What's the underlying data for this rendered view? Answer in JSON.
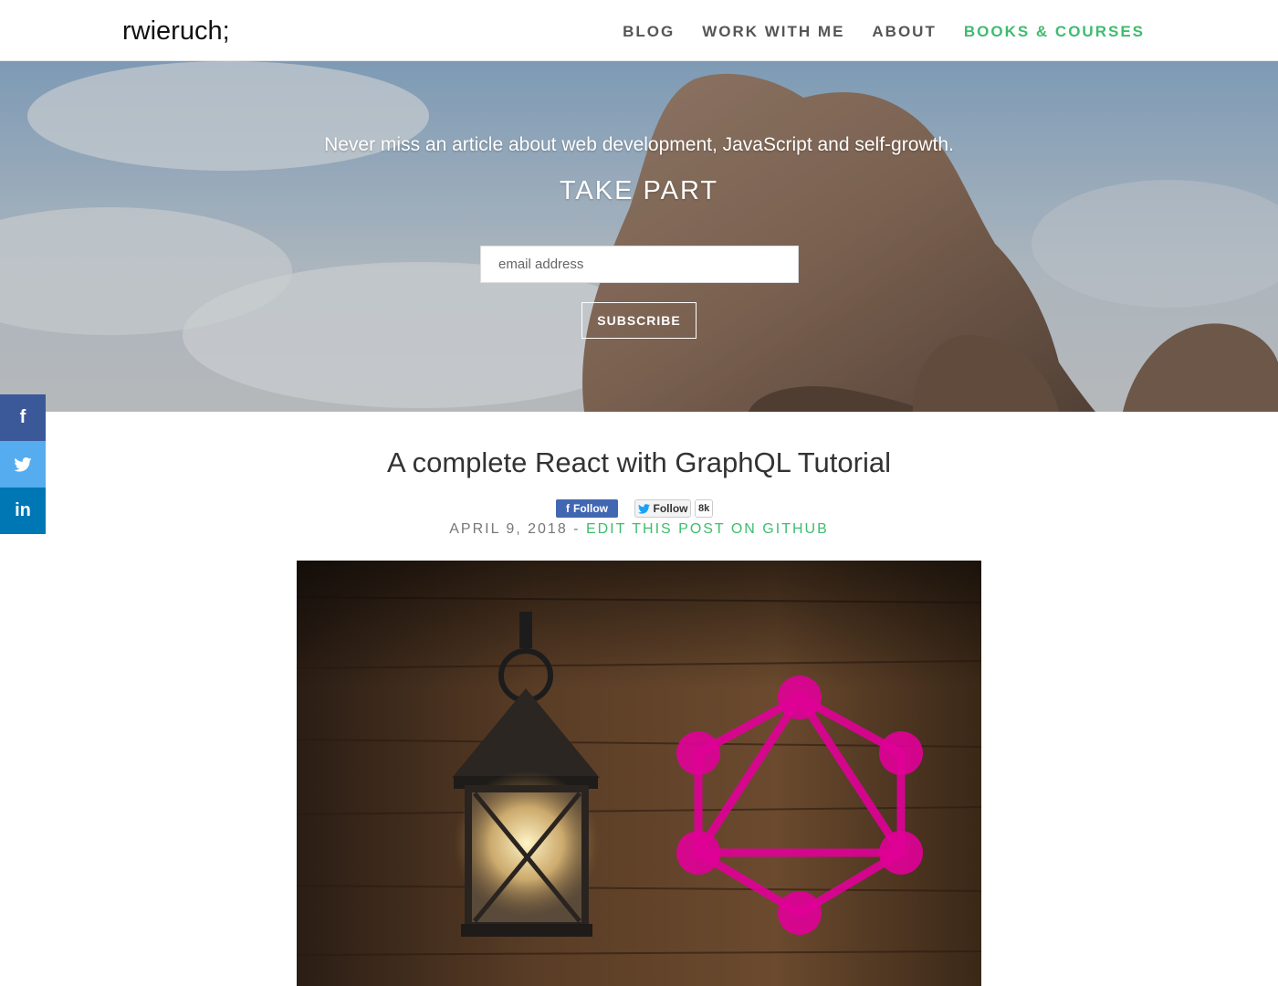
{
  "header": {
    "logo": "rwieruch;",
    "nav": [
      {
        "label": "BLOG"
      },
      {
        "label": "WORK WITH ME"
      },
      {
        "label": "ABOUT"
      },
      {
        "label": "BOOKS & COURSES"
      }
    ],
    "accent_color": "#3ebc6f"
  },
  "hero": {
    "tagline": "Never miss an article about web development, JavaScript and self-growth.",
    "title": "TAKE PART",
    "email_placeholder": "email address",
    "subscribe_label": "SUBSCRIBE"
  },
  "social": {
    "items": [
      {
        "icon": "facebook-icon",
        "glyph": "f",
        "color": "#3b5998"
      },
      {
        "icon": "twitter-icon",
        "glyph": "🐦",
        "color": "#55acee"
      },
      {
        "icon": "linkedin-icon",
        "glyph": "in",
        "color": "#0077b5"
      }
    ]
  },
  "post": {
    "title": "A complete React with GraphQL Tutorial",
    "fb_follow_label": "Follow",
    "tw_follow_label": "Follow",
    "tw_follow_count": "8k",
    "date": "APRIL 9, 2018",
    "separator": " - ",
    "edit_link": "EDIT THIS POST ON GITHUB"
  }
}
